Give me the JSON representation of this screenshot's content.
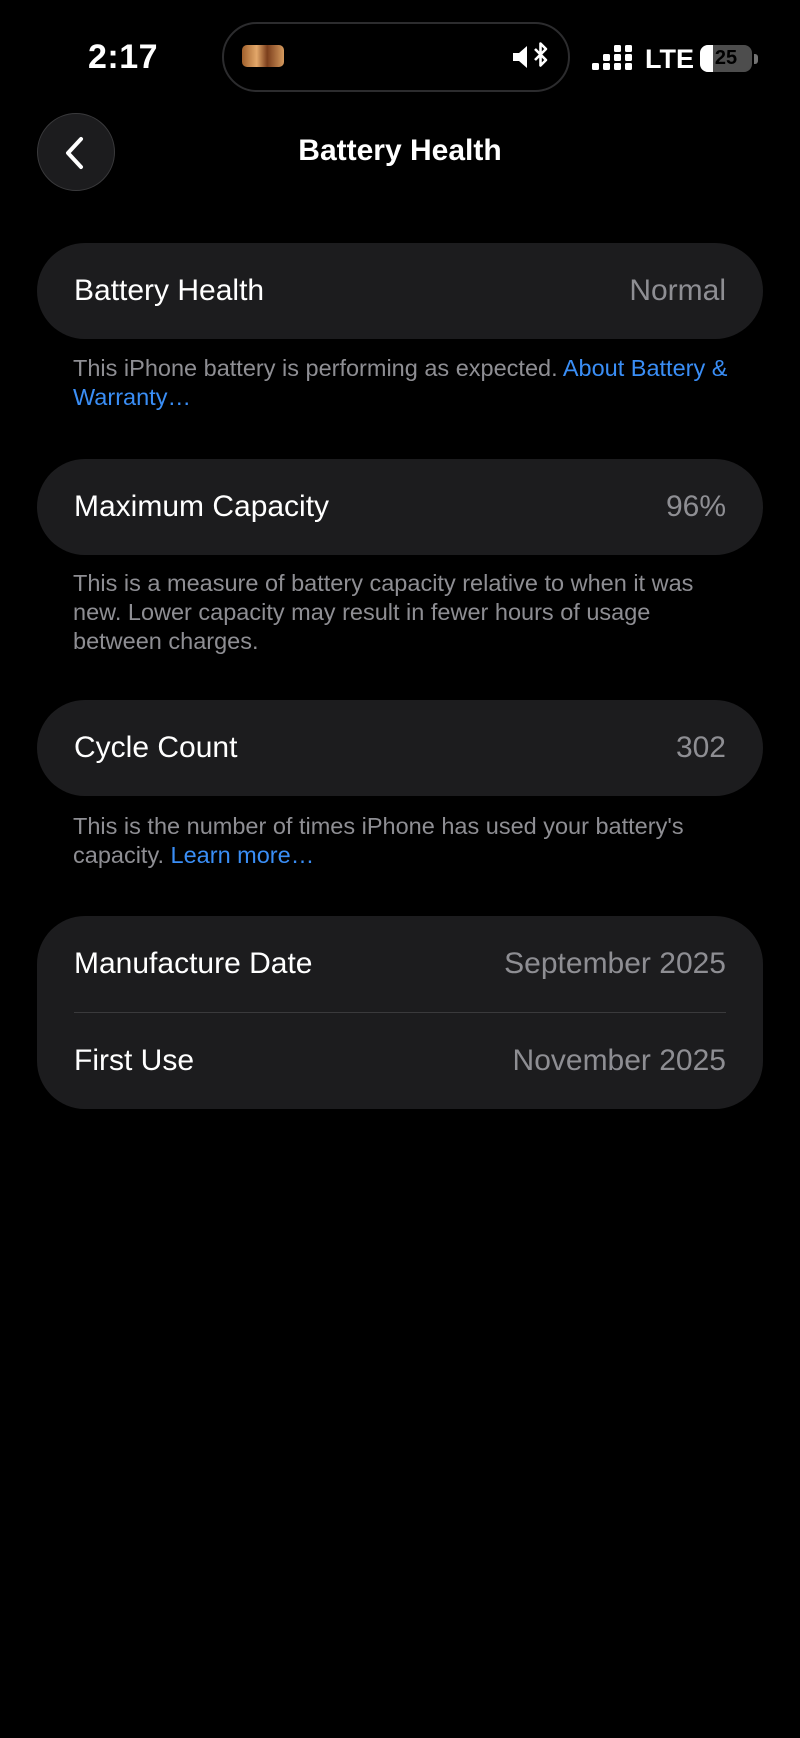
{
  "status_bar": {
    "time": "2:17",
    "network": "LTE",
    "battery_level": "25",
    "battery_fraction": 0.25,
    "island_icons": [
      "now-playing-artwork-icon",
      "silent-mode-icon"
    ]
  },
  "nav": {
    "title": "Battery Health",
    "back_icon": "chevron-left-icon"
  },
  "battery_health": {
    "label": "Battery Health",
    "value": "Normal",
    "footnote": "This iPhone battery is performing as expected.",
    "footnote_link": "About Battery & Warranty…"
  },
  "max_capacity": {
    "label": "Maximum Capacity",
    "value": "96%",
    "footnote": "This is a measure of battery capacity relative to when it was new. Lower capacity may result in fewer hours of usage between charges."
  },
  "cycle_count": {
    "label": "Cycle Count",
    "value": "302",
    "footnote": "This is the number of times iPhone has used your battery's capacity.",
    "footnote_link": "Learn more…"
  },
  "dates": {
    "manufacture_label": "Manufacture Date",
    "manufacture_value": "September 2025",
    "first_use_label": "First Use",
    "first_use_value": "November 2025"
  },
  "colors": {
    "background": "#000000",
    "card": "#1c1c1e",
    "secondary_text": "#8e8e93",
    "link": "#3a8ef6"
  }
}
